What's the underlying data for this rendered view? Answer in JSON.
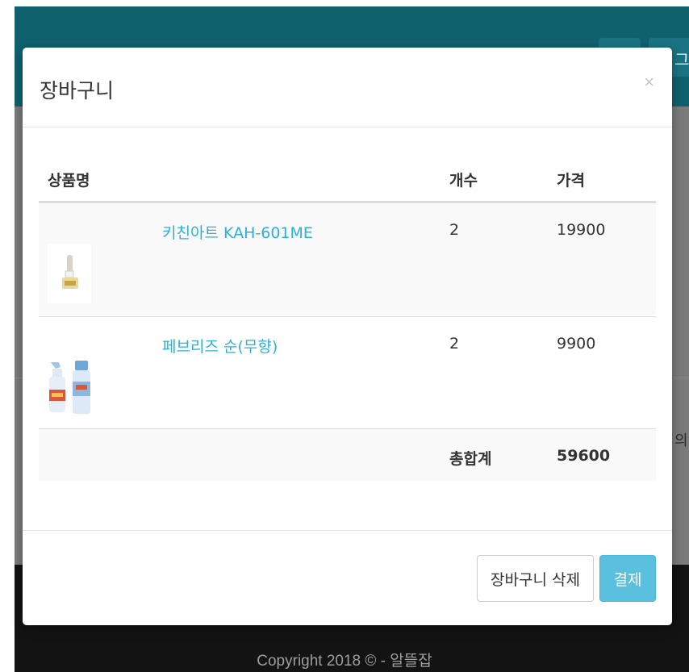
{
  "background": {
    "header_button_text": "그",
    "body_text": "의",
    "footer_text": "Copyright 2018 © - 알뜰잡"
  },
  "modal": {
    "title": "장바구니",
    "close_label": "×",
    "columns": {
      "name": "상품명",
      "qty": "개수",
      "price": "가격"
    },
    "items": [
      {
        "name": "키친아트 KAH-601ME",
        "qty": "2",
        "price": "19900",
        "thumb_icon": "kitchen-product-thumbnail"
      },
      {
        "name": "페브리즈 순(무향)",
        "qty": "2",
        "price": "9900",
        "thumb_icon": "spray-bottles-thumbnail"
      }
    ],
    "total_label": "총합계",
    "total_value": "59600",
    "buttons": {
      "delete_cart": "장바구니 삭제",
      "pay": "결제"
    }
  },
  "colors": {
    "header_teal": "#10616e",
    "link_blue": "#2fb0d5",
    "pay_button": "#5bc0de",
    "footer_dark": "#131313"
  }
}
